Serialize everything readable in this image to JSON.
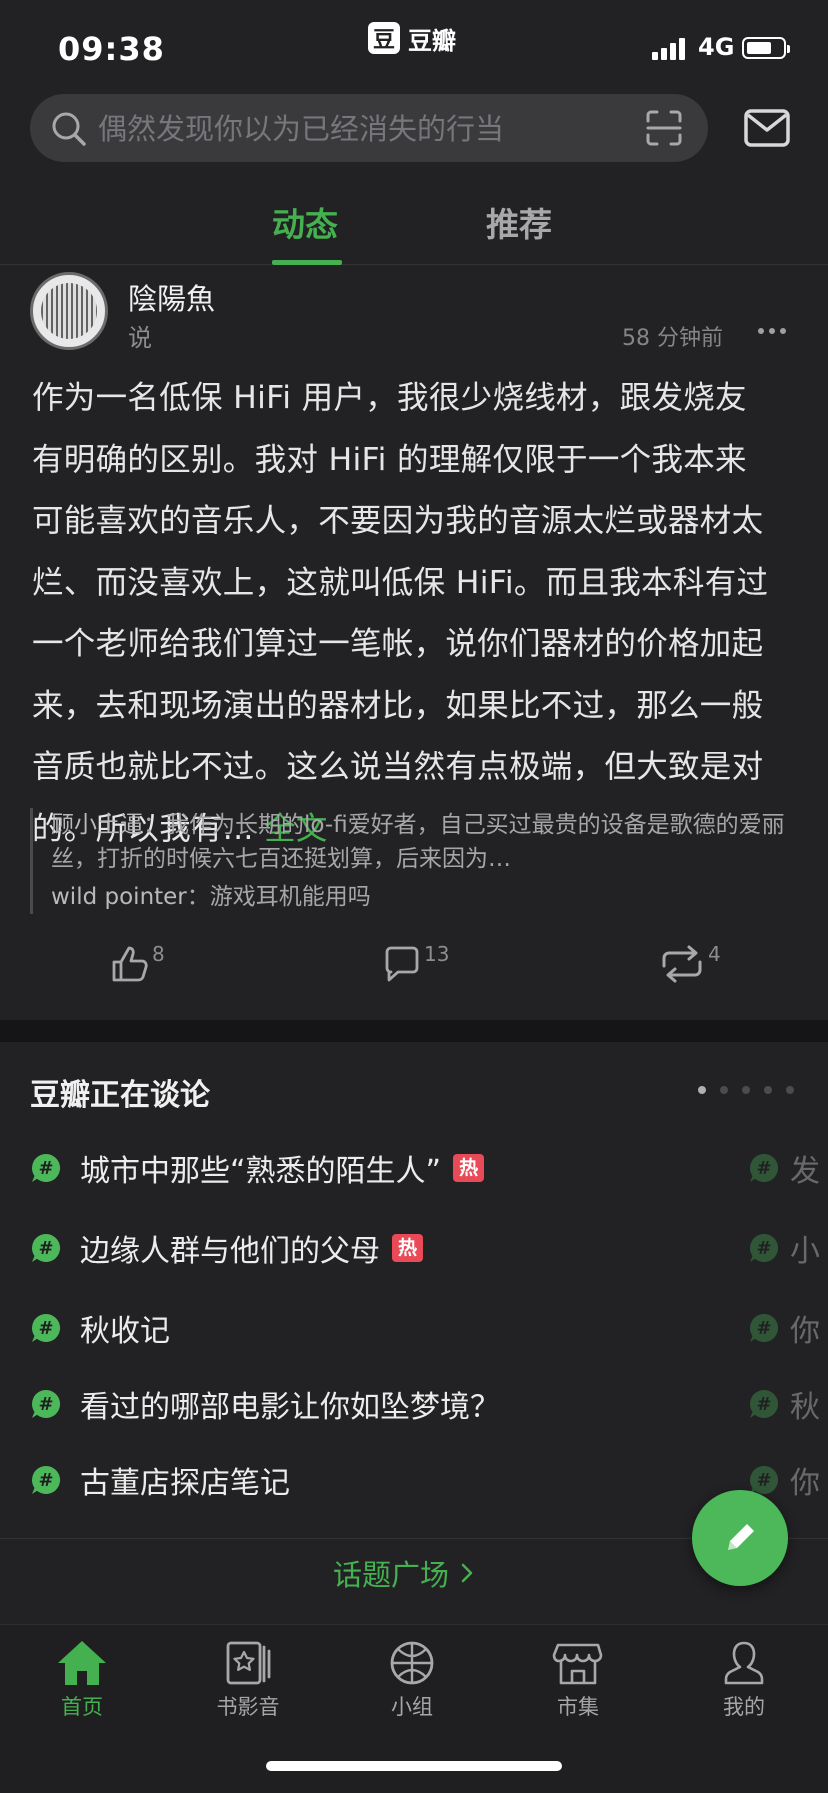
{
  "status_bar": {
    "time": "09:38",
    "app_brand_icon": "豆",
    "app_brand": "豆瓣",
    "network": "4G"
  },
  "search": {
    "placeholder": "偶然发现你以为已经消失的行当"
  },
  "tabs": [
    {
      "label": "动态",
      "active": true
    },
    {
      "label": "推荐",
      "active": false
    }
  ],
  "post": {
    "author": "陰陽魚",
    "verb": "说",
    "time_ago": "58 分钟前",
    "text": "作为一名低保 HiFi 用户，我很少烧线材，跟发烧友有明确的区别。我对 HiFi 的理解仅限于一个我本来可能喜欢的音乐人，不要因为我的音源太烂或器材太烂、而没喜欢上，这就叫低保 HiFi。而且我本科有过一个老师给我们算过一笔帐，说你们器材的价格加起来，去和现场演出的器材比，如果比不过，那么一般音质也就比不过。这么说当然有点极端，但大致是对的。所以我有...",
    "read_more": "全文",
    "comments": [
      {
        "name": "顾小土逼",
        "sep": "：",
        "text": "我作为长期的lo-fi爱好者，自己买过最贵的设备是歌德的爱丽丝，打折的时候六七百还挺划算，后来因为…"
      },
      {
        "name": "wild pointer",
        "sep": "：",
        "text": "游戏耳机能用吗"
      }
    ],
    "likes": "8",
    "comment_count": "13",
    "reposts": "4"
  },
  "topics": {
    "title": "豆瓣正在谈论",
    "items": [
      {
        "label": "城市中那些“熟悉的陌生人”",
        "hot": true,
        "hot_label": "热"
      },
      {
        "label": "边缘人群与他们的父母",
        "hot": true,
        "hot_label": "热"
      },
      {
        "label": "秋收记",
        "hot": false
      },
      {
        "label": "看过的哪部电影让你如坠梦境？",
        "hot": false
      },
      {
        "label": "古董店探店笔记",
        "hot": false
      }
    ],
    "peek_items": [
      "发",
      "小",
      "你",
      "秋",
      "你"
    ],
    "square_label": "话题广场",
    "page_dots": 5,
    "active_dot": 0
  },
  "nav": [
    {
      "label": "首页",
      "icon": "home-icon",
      "active": true
    },
    {
      "label": "书影音",
      "icon": "book-movie-music-icon",
      "active": false
    },
    {
      "label": "小组",
      "icon": "group-icon",
      "active": false
    },
    {
      "label": "市集",
      "icon": "market-icon",
      "active": false
    },
    {
      "label": "我的",
      "icon": "profile-icon",
      "active": false
    }
  ],
  "colors": {
    "accent": "#44b04f",
    "background": "#222225",
    "hot": "#e94a57"
  }
}
